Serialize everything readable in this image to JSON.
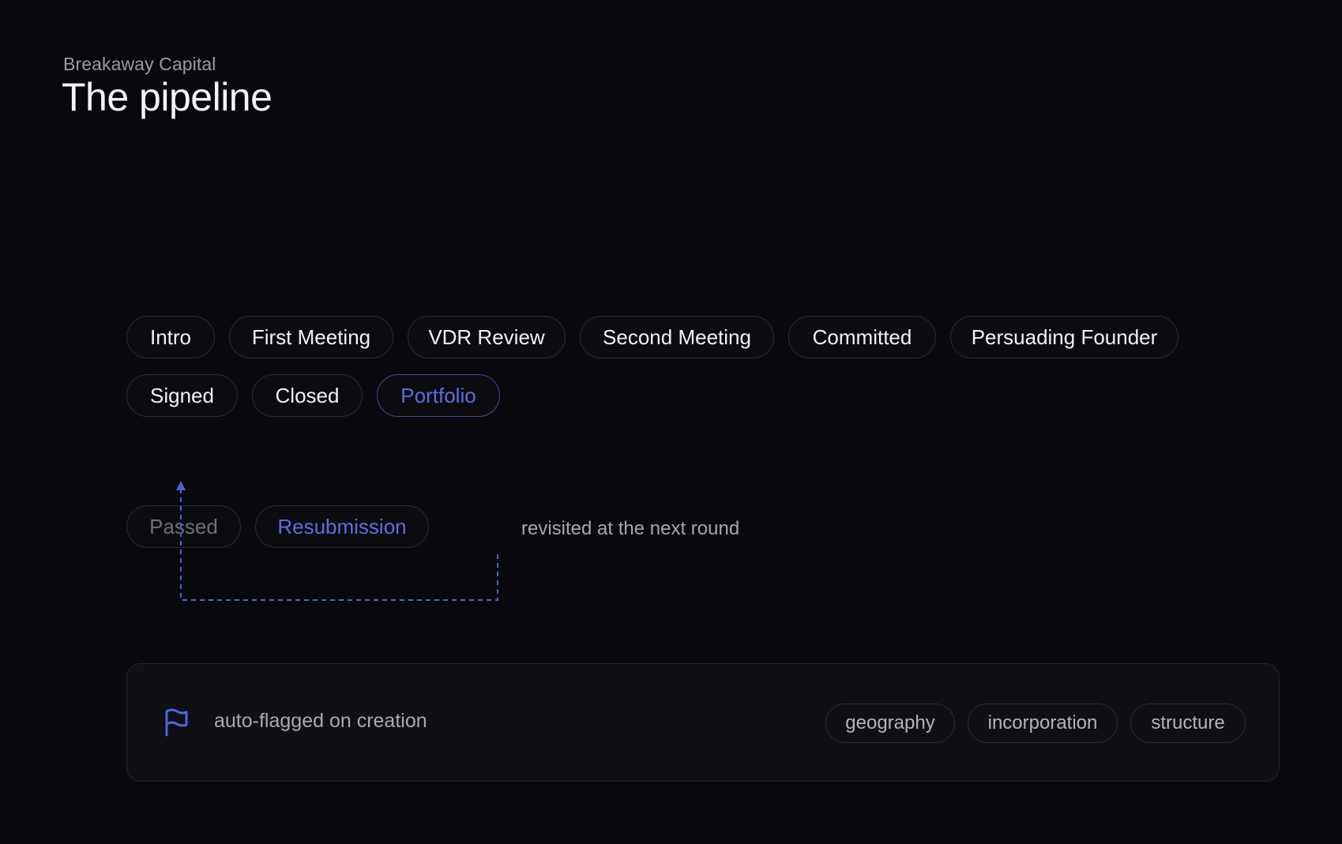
{
  "header": {
    "eyebrow": "Breakaway Capital",
    "title": "The pipeline"
  },
  "stages": {
    "row1": [
      "Intro",
      "First Meeting",
      "VDR Review",
      "Second Meeting",
      "Committed",
      "Persuading Founder"
    ],
    "row2": [
      "Signed",
      "Closed",
      "Portfolio"
    ],
    "active_stage": "Portfolio"
  },
  "side_path": {
    "passed_label": "Passed",
    "resubmission_label": "Resubmission",
    "note": "revisited at the next round"
  },
  "flag_panel": {
    "icon": "flag-icon",
    "text": "auto-flagged on creation",
    "tags": [
      "geography",
      "incorporation",
      "structure"
    ]
  },
  "colors": {
    "background": "#09090d",
    "accent": "#5a6fe0",
    "border": "#2b2b33"
  }
}
